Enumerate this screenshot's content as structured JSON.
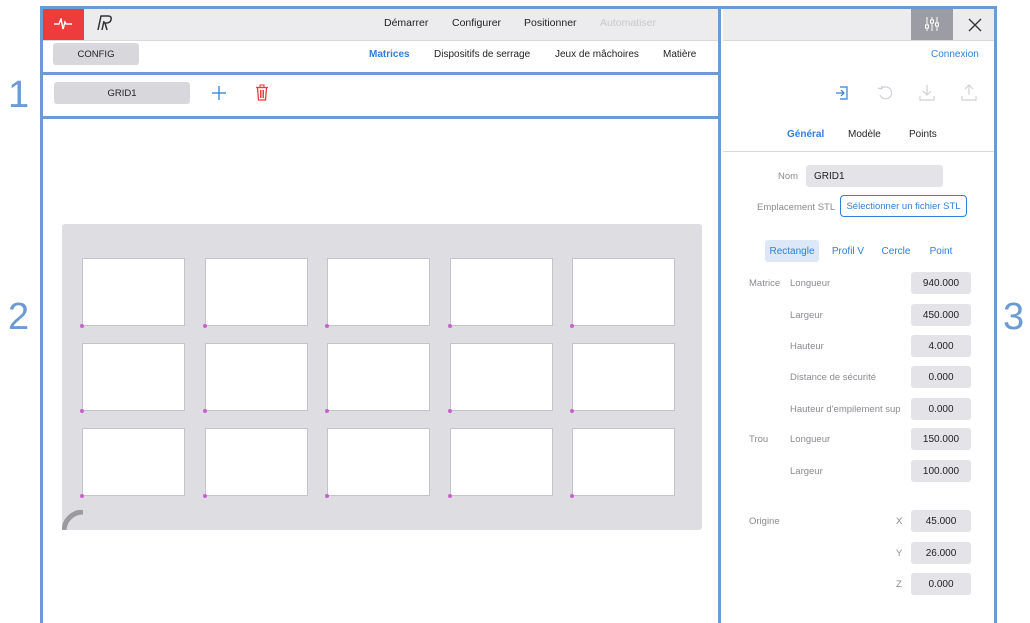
{
  "region_labels": [
    "1",
    "2",
    "3"
  ],
  "nav": {
    "items": [
      "Démarrer",
      "Configurer",
      "Positionner",
      "Automatiser"
    ],
    "config_label": "CONFIG",
    "subnav": [
      "Matrices",
      "Dispositifs de serrage",
      "Jeux de mâchoires",
      "Matière"
    ]
  },
  "toolbar": {
    "grid_tab": "GRID1"
  },
  "canvas": {
    "rows": 3,
    "cols": 5
  },
  "panel": {
    "connexion": "Connexion",
    "tabs": [
      "Général",
      "Modèle",
      "Points"
    ],
    "name_label": "Nom",
    "name_value": "GRID1",
    "stl_label": "Emplacement STL",
    "stl_button": "Sélectionner un fichier STL",
    "shapes": [
      "Rectangle",
      "Profil V",
      "Cercle",
      "Point"
    ],
    "matrice_label": "Matrice",
    "fields": [
      {
        "label": "Longueur",
        "value": "940.000"
      },
      {
        "label": "Largeur",
        "value": "450.000"
      },
      {
        "label": "Hauteur",
        "value": "4.000"
      },
      {
        "label": "Distance de sécurité",
        "value": "0.000"
      },
      {
        "label": "Hauteur d'empilement sup",
        "value": "0.000"
      }
    ],
    "trou_label": "Trou",
    "trou_fields": [
      {
        "label": "Longueur",
        "value": "150.000"
      },
      {
        "label": "Largeur",
        "value": "100.000"
      }
    ],
    "origine_label": "Origine",
    "origin": [
      {
        "axis": "X",
        "value": "45.000"
      },
      {
        "axis": "Y",
        "value": "26.000"
      },
      {
        "axis": "Z",
        "value": "0.000"
      }
    ]
  },
  "colors": {
    "accent": "#2f7fd8",
    "danger": "#ee3b3b",
    "region_border": "#6b9bd2"
  }
}
